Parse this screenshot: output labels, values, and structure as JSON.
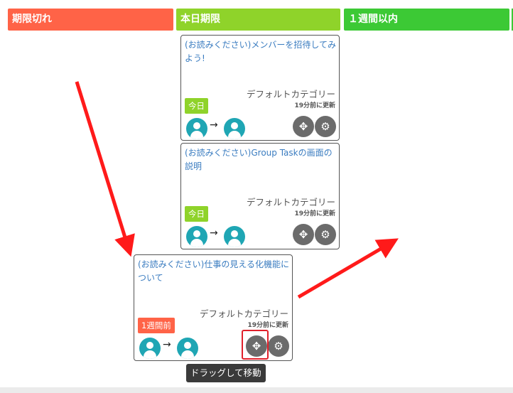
{
  "columns": [
    {
      "label": "期限切れ",
      "color": "#ff6347"
    },
    {
      "label": "本日期限",
      "color": "#8fd32a"
    },
    {
      "label": "１週間以内",
      "color": "#3cc935"
    }
  ],
  "cards": [
    {
      "title": "(お読みください)メンバーを招待してみよう!",
      "category": "デフォルトカテゴリー",
      "updated": "19分前に更新",
      "badge": "今日",
      "badge_color": "#8fd32a"
    },
    {
      "title": "(お読みください)Group Taskの画面の説明",
      "category": "デフォルトカテゴリー",
      "updated": "19分前に更新",
      "badge": "今日",
      "badge_color": "#8fd32a"
    },
    {
      "title": "(お読みください)仕事の見える化機能について",
      "category": "デフォルトカテゴリー",
      "updated": "19分前に更新",
      "badge": "1週間前",
      "badge_color": "#ff6347"
    }
  ],
  "card_controls": {
    "arrow": "→",
    "move_icon": "move-icon",
    "settings_icon": "gear-icon"
  },
  "tooltip": "ドラッグして移動",
  "annotation_color": "#ff1a1a"
}
